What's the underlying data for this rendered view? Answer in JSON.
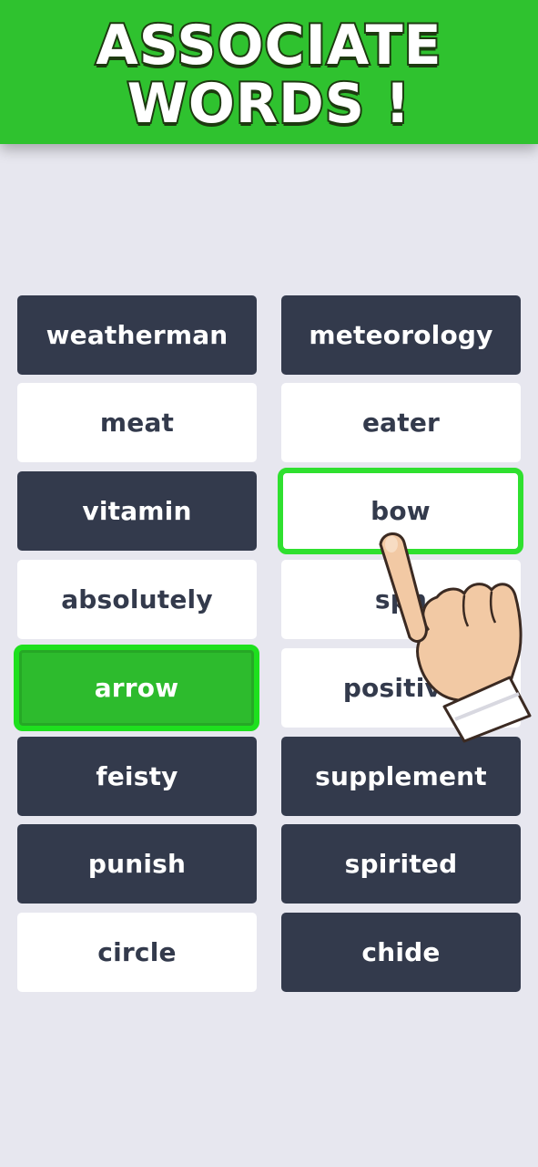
{
  "banner": {
    "line1": "ASSOCIATE",
    "line2": "WORDS !"
  },
  "tiles": {
    "left": [
      {
        "label": "weatherman",
        "style": "dark"
      },
      {
        "label": "meat",
        "style": "light"
      },
      {
        "label": "vitamin",
        "style": "dark"
      },
      {
        "label": "absolutely",
        "style": "light"
      },
      {
        "label": "arrow",
        "style": "selected"
      },
      {
        "label": "feisty",
        "style": "dark"
      },
      {
        "label": "punish",
        "style": "dark"
      },
      {
        "label": "circle",
        "style": "light"
      }
    ],
    "right": [
      {
        "label": "meteorology",
        "style": "dark"
      },
      {
        "label": "eater",
        "style": "light"
      },
      {
        "label": "bow",
        "style": "highlighted"
      },
      {
        "label": "sph",
        "style": "light"
      },
      {
        "label": "positive",
        "style": "light"
      },
      {
        "label": "supplement",
        "style": "dark"
      },
      {
        "label": "spirited",
        "style": "dark"
      },
      {
        "label": "chide",
        "style": "dark"
      }
    ]
  },
  "overlay": {
    "icon": "pointing-hand-icon"
  },
  "colors": {
    "banner_green": "#2fc22f",
    "tile_dark": "#333a4c",
    "tile_light": "#ffffff",
    "selected_green": "#2dbb2d",
    "highlight_border": "#2fe02f",
    "background": "#e7e7ef"
  }
}
